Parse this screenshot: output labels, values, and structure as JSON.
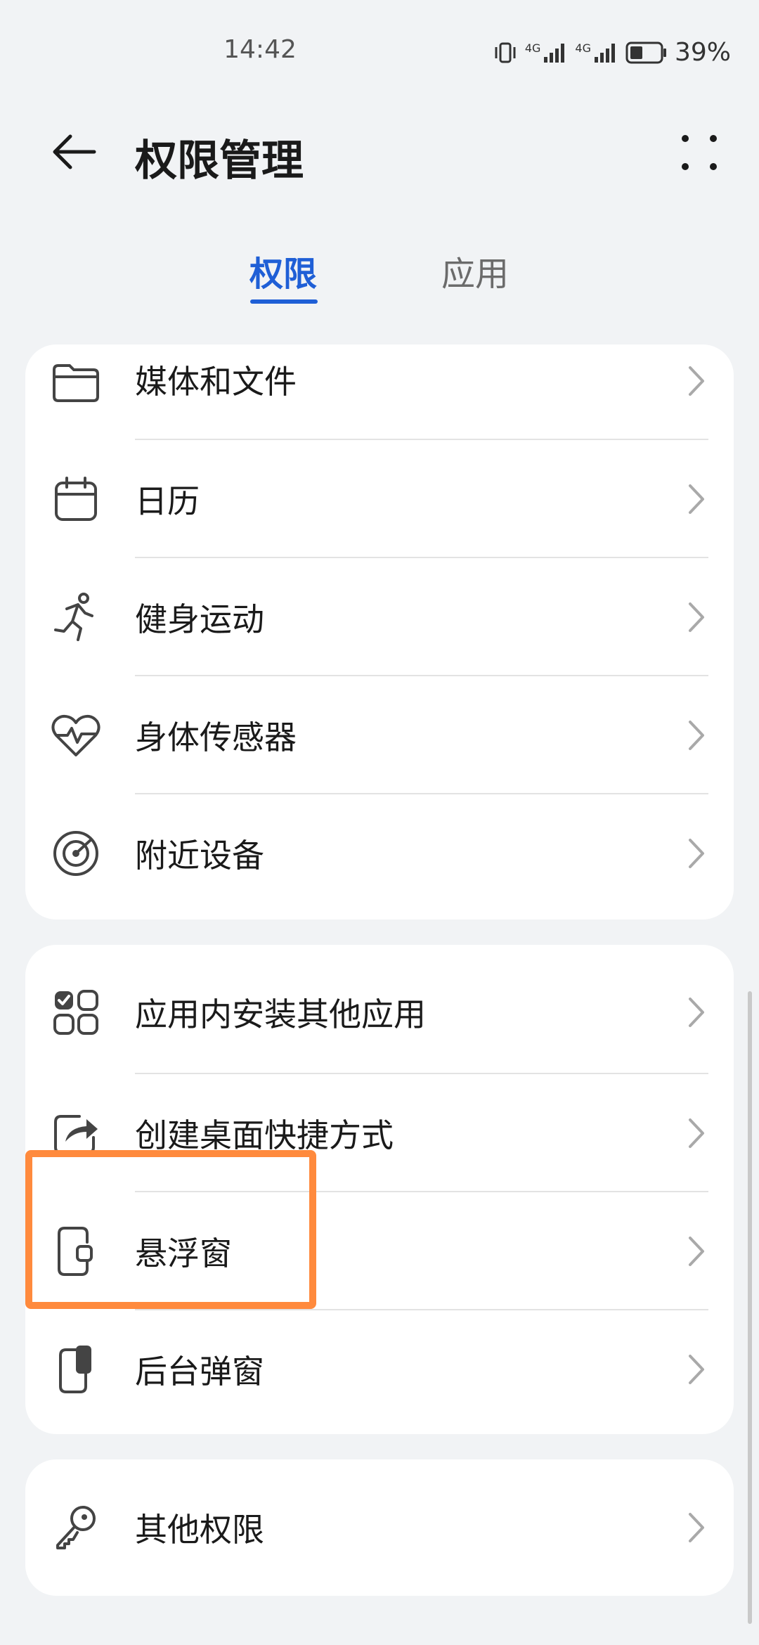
{
  "status_bar": {
    "time": "14:42",
    "battery_percent": "39%",
    "network_label_1": "4G",
    "network_label_2": "4G",
    "icons": [
      "vibrate-icon",
      "signal-4g-icon",
      "signal-4g-icon",
      "battery-icon"
    ]
  },
  "app_bar": {
    "title": "权限管理",
    "back_icon": "arrow-left-icon",
    "more_icon": "more-dots-icon"
  },
  "tabs": [
    {
      "label": "权限",
      "active": true
    },
    {
      "label": "应用",
      "active": false
    }
  ],
  "cards": [
    {
      "items": [
        {
          "label": "媒体和文件",
          "icon": "folder-icon"
        },
        {
          "label": "日历",
          "icon": "calendar-icon"
        },
        {
          "label": "健身运动",
          "icon": "running-icon"
        },
        {
          "label": "身体传感器",
          "icon": "heart-pulse-icon"
        },
        {
          "label": "附近设备",
          "icon": "radar-icon"
        }
      ]
    },
    {
      "items": [
        {
          "label": "应用内安装其他应用",
          "icon": "app-grid-icon"
        },
        {
          "label": "创建桌面快捷方式",
          "icon": "share-shortcut-icon"
        },
        {
          "label": "悬浮窗",
          "icon": "floating-window-icon"
        },
        {
          "label": "后台弹窗",
          "icon": "background-popup-icon"
        }
      ]
    },
    {
      "items": [
        {
          "label": "其他权限",
          "icon": "key-icon"
        }
      ]
    }
  ],
  "colors": {
    "accent": "#1f5fd6",
    "highlight": "#ff8a3d",
    "background": "#f1f3f5"
  }
}
